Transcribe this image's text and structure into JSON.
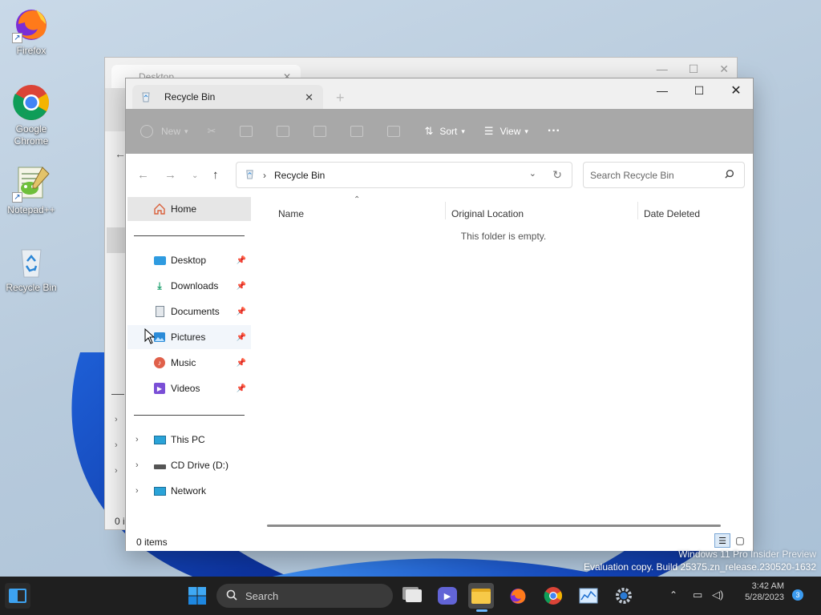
{
  "desktop": {
    "icons": [
      {
        "label": "Firefox",
        "icon": "firefox-icon"
      },
      {
        "label": "Google Chrome",
        "icon": "chrome-icon"
      },
      {
        "label": "Notepad++",
        "icon": "notepadpp-icon"
      },
      {
        "label": "Recycle Bin",
        "icon": "recycle-bin-icon"
      }
    ],
    "watermark_line1": "Windows 11 Pro Insider Preview",
    "watermark_line2": "Evaluation copy. Build 25375.zn_release.230520-1632"
  },
  "back_window": {
    "tab_title": "Desktop",
    "status_partial": "0 i"
  },
  "window": {
    "tab_title": "Recycle Bin",
    "toolbar": {
      "new_label": "New",
      "sort_label": "Sort",
      "view_label": "View",
      "more_label": "···"
    },
    "address": {
      "separator": "›",
      "location": "Recycle Bin",
      "search_placeholder": "Search Recycle Bin"
    },
    "nav": {
      "home": "Home",
      "quick_access": [
        {
          "label": "Desktop",
          "icon": "desktop-folder-icon",
          "color": "#2f9be0"
        },
        {
          "label": "Downloads",
          "icon": "download-icon",
          "color": "#1a9e6b"
        },
        {
          "label": "Documents",
          "icon": "documents-icon",
          "color": "#7d8a96"
        },
        {
          "label": "Pictures",
          "icon": "pictures-icon",
          "color": "#2b8bd8"
        },
        {
          "label": "Music",
          "icon": "music-icon",
          "color": "#e0604a"
        },
        {
          "label": "Videos",
          "icon": "videos-icon",
          "color": "#7a4fd6"
        }
      ],
      "drives": [
        {
          "label": "This PC",
          "icon": "this-pc-icon"
        },
        {
          "label": "CD Drive (D:)",
          "icon": "cd-drive-icon"
        },
        {
          "label": "Network",
          "icon": "network-icon"
        }
      ]
    },
    "columns": [
      "Name",
      "Original Location",
      "Date Deleted"
    ],
    "empty_message": "This folder is empty.",
    "status": "0 items"
  },
  "taskbar": {
    "search_label": "Search",
    "clock_time": "3:42 AM",
    "clock_date": "5/28/2023",
    "notification_count": "3"
  },
  "colors": {
    "accent": "#0067c0",
    "toolbar_bg": "#a8a8a8",
    "taskbar_bg": "#1f1f1f"
  }
}
